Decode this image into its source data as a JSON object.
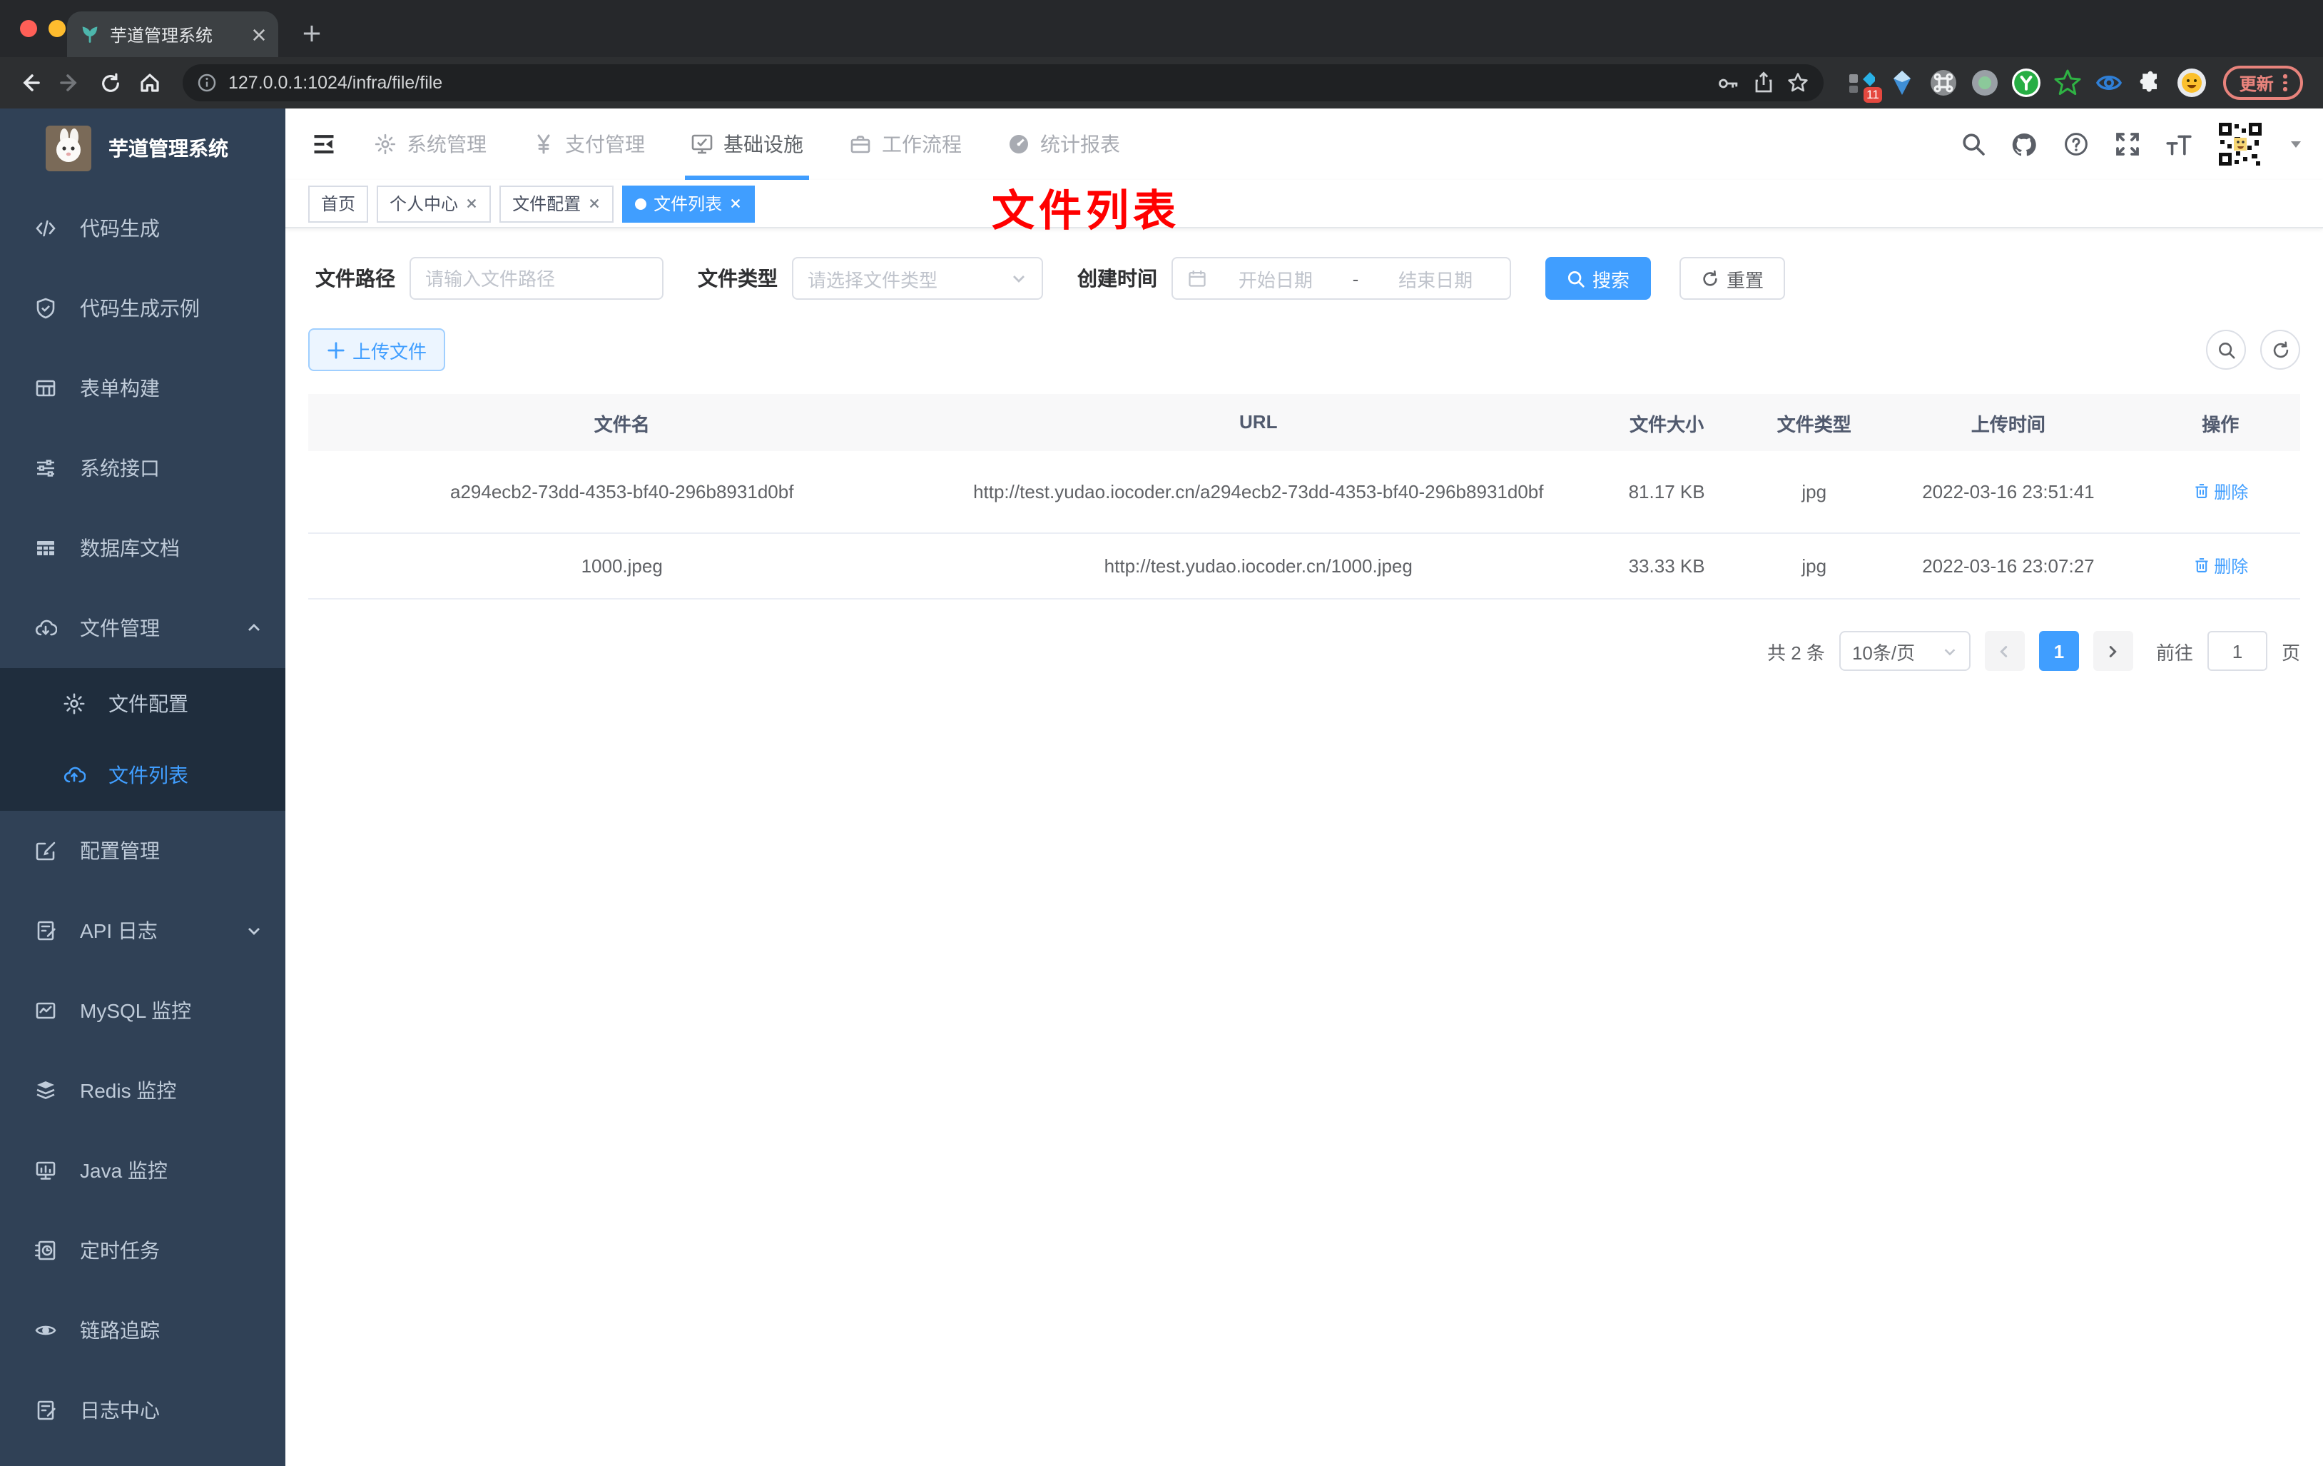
{
  "browser": {
    "tab_title": "芋道管理系统",
    "url": "127.0.0.1:1024/infra/file/file",
    "update_label": "更新",
    "extension_badge": "11",
    "colors": {
      "traffic_red": "#ff5f57",
      "traffic_yellow": "#febc2e",
      "traffic_green": "#28c840",
      "update_accent": "#e8837c"
    }
  },
  "sidebar": {
    "title": "芋道管理系统",
    "items": [
      {
        "label": "代码生成",
        "icon": "code-icon"
      },
      {
        "label": "代码生成示例",
        "icon": "shield-check-icon"
      },
      {
        "label": "表单构建",
        "icon": "form-table-icon"
      },
      {
        "label": "系统接口",
        "icon": "sliders-icon"
      },
      {
        "label": "数据库文档",
        "icon": "grid-filled-icon"
      },
      {
        "label": "文件管理",
        "icon": "cloud-download-icon",
        "expanded": true
      },
      {
        "label": "文件配置",
        "icon": "gear-icon",
        "submenu": true
      },
      {
        "label": "文件列表",
        "icon": "cloud-upload-icon",
        "submenu": true,
        "active": true
      },
      {
        "label": "配置管理",
        "icon": "edit-square-icon"
      },
      {
        "label": "API 日志",
        "icon": "document-edit-icon",
        "collapsed": true
      },
      {
        "label": "MySQL 监控",
        "icon": "chart-box-icon"
      },
      {
        "label": "Redis 监控",
        "icon": "layers-icon"
      },
      {
        "label": "Java 监控",
        "icon": "monitor-icon"
      },
      {
        "label": "定时任务",
        "icon": "schedule-icon"
      },
      {
        "label": "链路追踪",
        "icon": "eye-icon"
      },
      {
        "label": "日志中心",
        "icon": "log-edit-icon"
      }
    ]
  },
  "topnav": {
    "items": [
      {
        "label": "系统管理",
        "icon": "gear-icon"
      },
      {
        "label": "支付管理",
        "icon": "yen-icon"
      },
      {
        "label": "基础设施",
        "icon": "monitor-check-icon",
        "active": true
      },
      {
        "label": "工作流程",
        "icon": "briefcase-icon"
      },
      {
        "label": "统计报表",
        "icon": "dashboard-icon"
      }
    ]
  },
  "tags": [
    {
      "label": "首页",
      "closable": false,
      "active": false
    },
    {
      "label": "个人中心",
      "closable": true,
      "active": false
    },
    {
      "label": "文件配置",
      "closable": true,
      "active": false
    },
    {
      "label": "文件列表",
      "closable": true,
      "active": true
    }
  ],
  "annotation": "文件列表",
  "filters": {
    "path_label": "文件路径",
    "path_placeholder": "请输入文件路径",
    "type_label": "文件类型",
    "type_placeholder": "请选择文件类型",
    "date_label": "创建时间",
    "date_start_placeholder": "开始日期",
    "date_separator": "-",
    "date_end_placeholder": "结束日期",
    "search_label": "搜索",
    "reset_label": "重置"
  },
  "toolbar": {
    "upload_label": "上传文件"
  },
  "table": {
    "headers": [
      "文件名",
      "URL",
      "文件大小",
      "文件类型",
      "上传时间",
      "操作"
    ],
    "rows": [
      {
        "name": "a294ecb2-73dd-4353-bf40-296b8931d0bf",
        "url": "http://test.yudao.iocoder.cn/a294ecb2-73dd-4353-bf40-296b8931d0bf",
        "size": "81.17 KB",
        "type": "jpg",
        "time": "2022-03-16 23:51:41",
        "action": "删除"
      },
      {
        "name": "1000.jpeg",
        "url": "http://test.yudao.iocoder.cn/1000.jpeg",
        "size": "33.33 KB",
        "type": "jpg",
        "time": "2022-03-16 23:07:27",
        "action": "删除"
      }
    ]
  },
  "pagination": {
    "total": "共 2 条",
    "page_size": "10条/页",
    "current_page": "1",
    "goto_label": "前往",
    "goto_value": "1",
    "page_unit": "页"
  },
  "colors": {
    "accent": "#409eff",
    "sidebar_bg": "#304156",
    "submenu_bg": "#1f2d3d",
    "annotation": "#ff0000"
  }
}
